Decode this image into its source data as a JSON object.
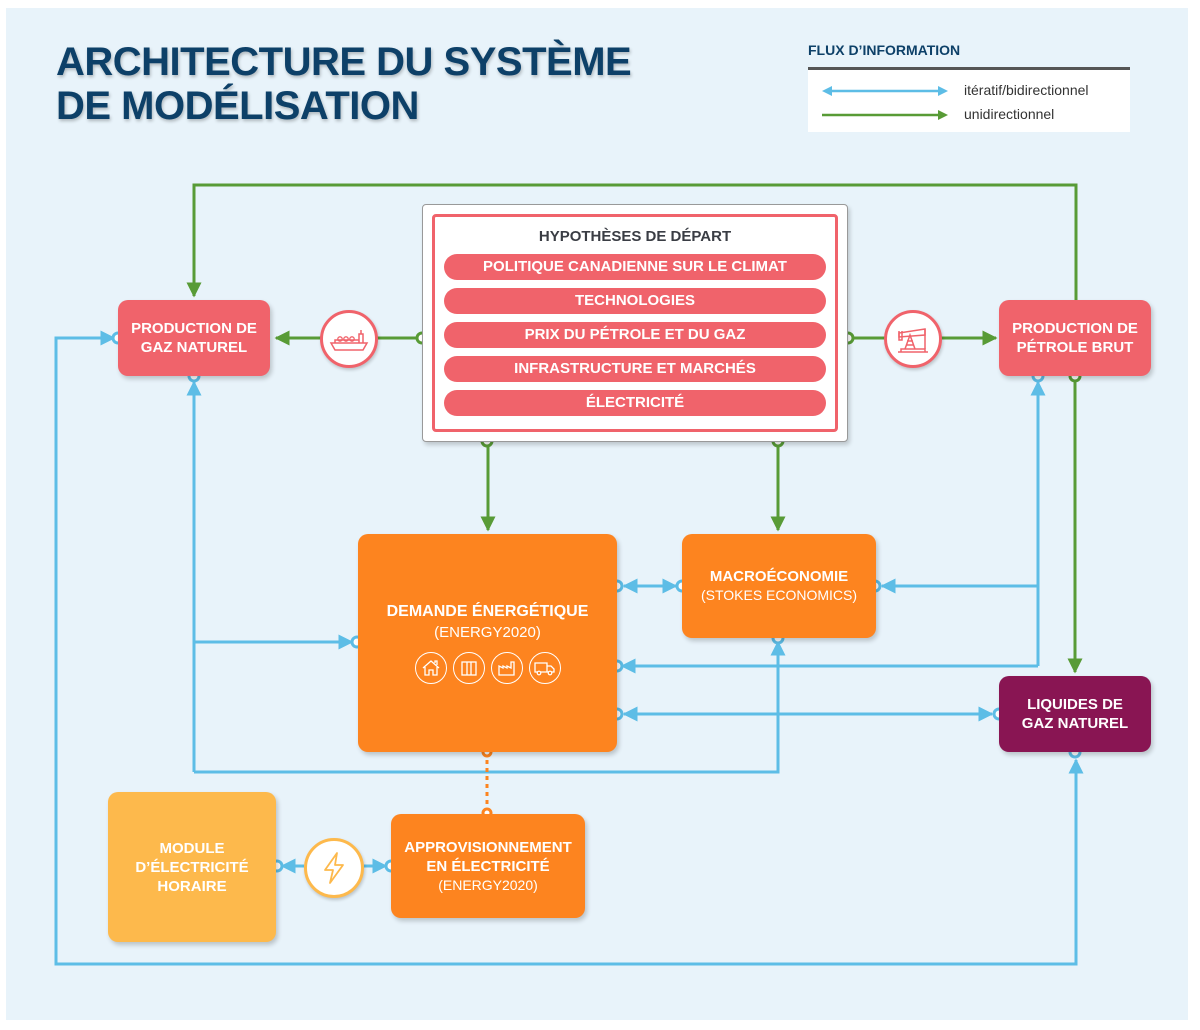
{
  "title": {
    "line1": "ARCHITECTURE DU SYSTÈME",
    "line2": "DE MODÉLISATION"
  },
  "legend": {
    "title": "FLUX D’INFORMATION",
    "items": [
      {
        "label": "itératif/bidirectionnel",
        "kind": "bidirectional",
        "color": "#5dbde6"
      },
      {
        "label": "unidirectionnel",
        "kind": "unidirectional",
        "color": "#589b36"
      }
    ]
  },
  "colors": {
    "bidirectional": "#5dbde6",
    "unidirectional": "#589b36",
    "production": "#f0636b",
    "demand": "#fd841f",
    "hourly_module": "#fdb94c",
    "ngl": "#891553",
    "title": "#0d4068"
  },
  "hypotheses": {
    "title": "HYPOTHÈSES DE DÉPART",
    "items": [
      "POLITIQUE CANADIENNE SUR LE CLIMAT",
      "TECHNOLOGIES",
      "PRIX DU PÉTROLE ET DU GAZ",
      "INFRASTRUCTURE ET MARCHÉS",
      "ÉLECTRICITÉ"
    ]
  },
  "nodes": {
    "gas_production": {
      "line1": "PRODUCTION DE",
      "line2": "GAZ NATUREL"
    },
    "oil_production": {
      "line1": "PRODUCTION DE",
      "line2": "PÉTROLE BRUT"
    },
    "energy_demand": {
      "line1": "DEMANDE ÉNERGÉTIQUE",
      "sub": "(ENERGY2020)",
      "icons": [
        "house-icon",
        "building-icon",
        "factory-icon",
        "truck-icon"
      ]
    },
    "macroeconomy": {
      "line1": "MACROÉCONOMIE",
      "sub": "(STOKES ECONOMICS)"
    },
    "ngl": {
      "line1": "LIQUIDES DE",
      "line2": "GAZ NATUREL"
    },
    "hourly_module": {
      "line1": "MODULE",
      "line2": "D’ÉLECTRICITÉ",
      "line3": "HORAIRE"
    },
    "electricity_supply": {
      "line1": "APPROVISIONNEMENT",
      "line2": "EN ÉLECTRICITÉ",
      "sub": "(ENERGY2020)"
    }
  },
  "connector_icons": [
    "lng-tanker-icon",
    "oil-pumpjack-icon",
    "lightning-bolt-icon"
  ]
}
